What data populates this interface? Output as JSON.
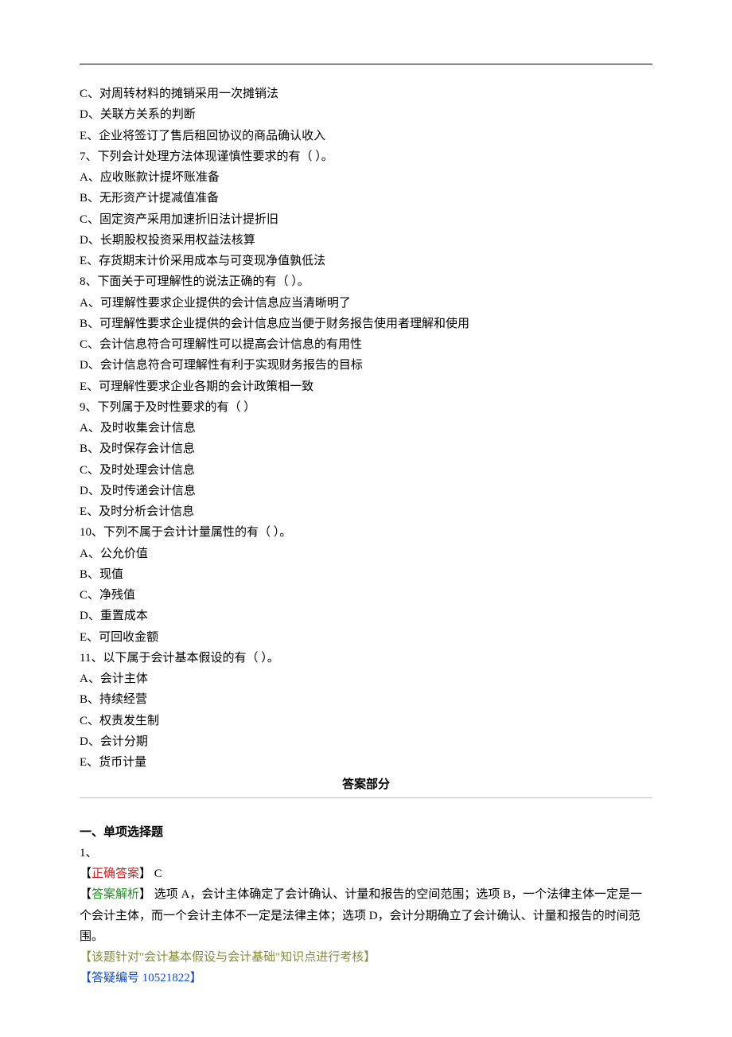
{
  "q6_optC": "C、对周转材料的摊销采用一次摊销法",
  "q6_optD": "D、关联方关系的判断",
  "q6_optE": "E、企业将签订了售后租回协议的商品确认收入",
  "q7_stem": "7、下列会计处理方法体现谨慎性要求的有（ ）。",
  "q7_optA": "A、应收账款计提坏账准备",
  "q7_optB": "B、无形资产计提减值准备",
  "q7_optC": "C、固定资产采用加速折旧法计提折旧",
  "q7_optD": "D、长期股权投资采用权益法核算",
  "q7_optE": "E、存货期末计价采用成本与可变现净值孰低法",
  "q8_stem": "8、下面关于可理解性的说法正确的有（ ）。",
  "q8_optA": "A、可理解性要求企业提供的会计信息应当清晰明了",
  "q8_optB": "B、可理解性要求企业提供的会计信息应当便于财务报告使用者理解和使用",
  "q8_optC": "C、会计信息符合可理解性可以提高会计信息的有用性",
  "q8_optD": "D、会计信息符合可理解性有利于实现财务报告的目标",
  "q8_optE": "E、可理解性要求企业各期的会计政策相一致",
  "q9_stem": "9、下列属于及时性要求的有（ ）",
  "q9_optA": "A、及时收集会计信息",
  "q9_optB": "B、及时保存会计信息",
  "q9_optC": "C、及时处理会计信息",
  "q9_optD": "D、及时传递会计信息",
  "q9_optE": "E、及时分析会计信息",
  "q10_stem": "10、下列不属于会计计量属性的有（ ）。",
  "q10_optA": "A、公允价值",
  "q10_optB": "B、现值",
  "q10_optC": "C、净残值",
  "q10_optD": "D、重置成本",
  "q10_optE": "E、可回收金额",
  "q11_stem": "11、以下属于会计基本假设的有（ ）。",
  "q11_optA": "A、会计主体",
  "q11_optB": "B、持续经营",
  "q11_optC": "C、权责发生制",
  "q11_optD": "D、会计分期",
  "q11_optE": "E、货币计量",
  "answers_title": "答案部分",
  "section1_heading": "一、单项选择题",
  "a1_num": "1、",
  "a1_correct_label": "正确答案",
  "a1_correct_value": " C",
  "a1_analysis_label": "答案解析",
  "a1_analysis_text": " 选项 A，会计主体确定了会计确认、计量和报告的空间范围；选项 B，一个法律主体一定是一个会计主体，而一个会计主体不一定是法律主体；选项 D，会计分期确立了会计确认、计量和报告的时间范围。",
  "a1_topic_pre": "【该题针对\"",
  "a1_topic_link": "会计基本假设与会计基础",
  "a1_topic_post": "\"知识点进行考核】",
  "a1_ref": "【答疑编号 10521822】",
  "brackets": {
    "open": "【",
    "close": "】 "
  }
}
